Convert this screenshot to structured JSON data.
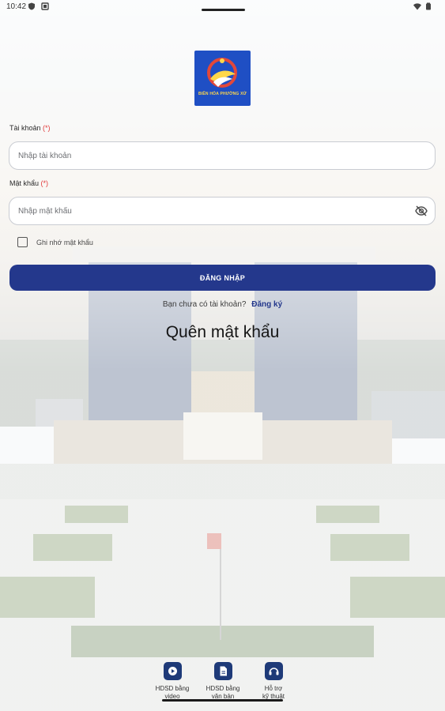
{
  "status_bar": {
    "time": "10:42"
  },
  "logo": {
    "text": "BIÊN HÒA PHƯỜNG XỨ"
  },
  "form": {
    "account_label": "Tài khoản",
    "account_required": "(*)",
    "account_placeholder": "Nhập tài khoản",
    "password_label": "Mật khẩu",
    "password_required": "(*)",
    "password_placeholder": "Nhập mật khẩu",
    "remember_label": "Ghi nhớ mật khẩu",
    "login_label": "ĐĂNG NHẬP",
    "register_question": "Bạn chưa có tài khoản?",
    "register_link": "Đăng ký",
    "forgot_password": "Quên mật khẩu"
  },
  "bottom_nav": {
    "items": [
      {
        "label": "HDSD bằng\nvideo",
        "icon": "play-icon"
      },
      {
        "label": "HDSD bằng\nvăn bản",
        "icon": "document-icon"
      },
      {
        "label": "Hỗ trợ\nkỹ thuật",
        "icon": "support-icon"
      }
    ]
  },
  "colors": {
    "primary": "#24388c",
    "required": "#e23b3b",
    "nav_icon": "#1e3a78"
  }
}
